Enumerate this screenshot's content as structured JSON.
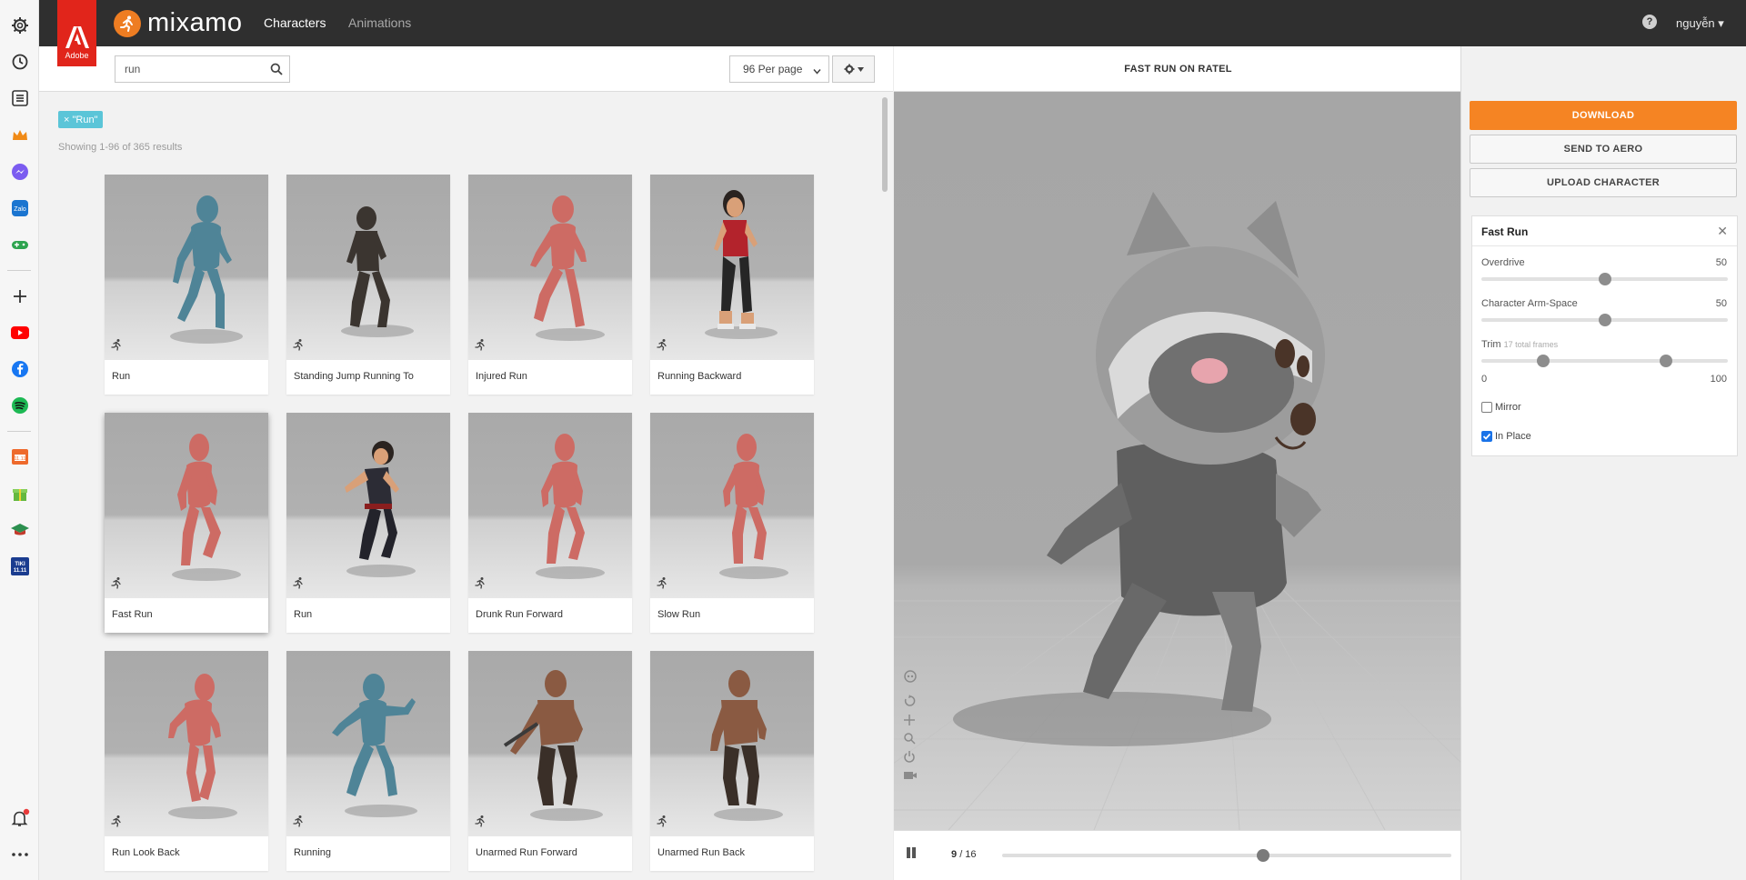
{
  "header": {
    "adobe_label": "Adobe",
    "logo_text": "mixamo",
    "nav": [
      "Characters",
      "Animations"
    ],
    "help_label": "?",
    "user_label": "nguyễn"
  },
  "browse": {
    "search_value": "run",
    "per_page": "96 Per page",
    "filter_tag": "× \"Run\"",
    "results_text": "Showing 1-96 of 365 results",
    "cards": [
      {
        "name": "Run"
      },
      {
        "name": "Standing Jump Running To"
      },
      {
        "name": "Injured Run"
      },
      {
        "name": "Running Backward"
      },
      {
        "name": "Fast Run"
      },
      {
        "name": "Run"
      },
      {
        "name": "Drunk Run Forward"
      },
      {
        "name": "Slow Run"
      },
      {
        "name": "Run Look Back"
      },
      {
        "name": "Running"
      },
      {
        "name": "Unarmed Run Forward"
      },
      {
        "name": "Unarmed Run Back"
      }
    ]
  },
  "viewer": {
    "title": "FAST RUN ON RATEL",
    "frame_current": "9",
    "frame_total": "/ 16",
    "playback_progress": 0.58
  },
  "panel": {
    "download_label": "DOWNLOAD",
    "aero_label": "SEND TO AERO",
    "upload_label": "UPLOAD CHARACTER",
    "settings_title": "Fast Run",
    "close_label": "✕",
    "overdrive_label": "Overdrive",
    "overdrive_value": "50",
    "armspace_label": "Character Arm-Space",
    "armspace_value": "50",
    "trim_label": "Trim",
    "trim_note": "17 total frames",
    "trim_min": "0",
    "trim_max": "100",
    "trim_start_pct": 25,
    "trim_end_pct": 75,
    "mirror_label": "Mirror",
    "inplace_label": "In Place",
    "mirror_checked": false,
    "inplace_checked": true
  }
}
